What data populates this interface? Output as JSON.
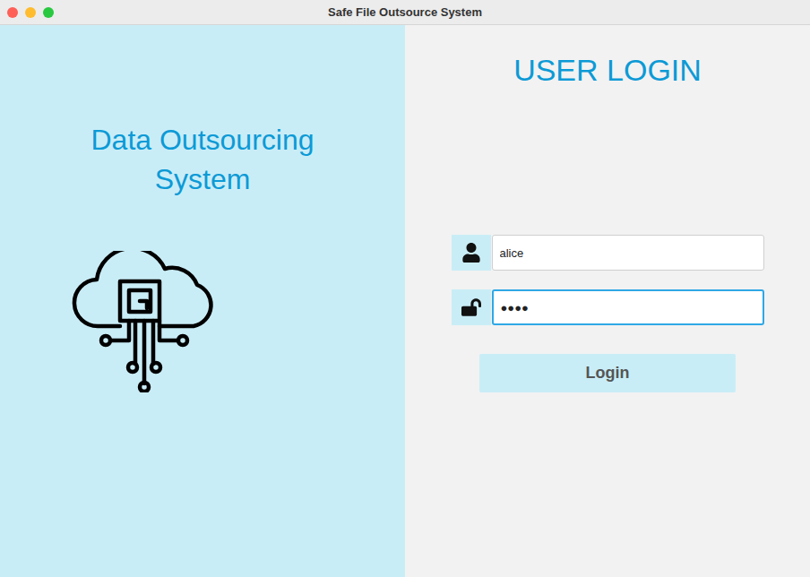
{
  "window": {
    "title": "Safe File Outsource System"
  },
  "brand": {
    "title": "Data Outsourcing System"
  },
  "login": {
    "heading": "USER LOGIN",
    "username": {
      "value": "alice",
      "focused": false
    },
    "password": {
      "value": "●●●●",
      "focused": true
    },
    "button": "Login"
  }
}
